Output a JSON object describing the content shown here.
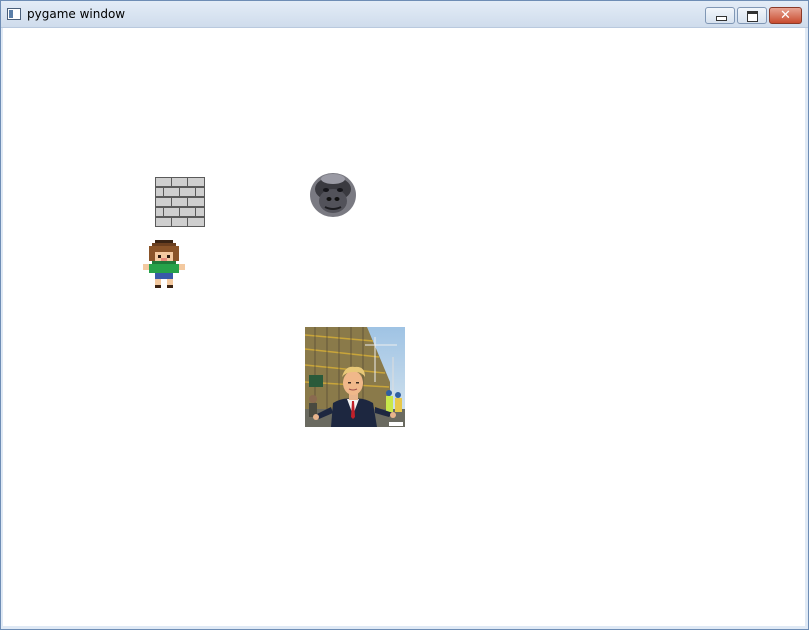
{
  "window": {
    "title": "pygame window",
    "icon": "pygame-app-icon",
    "controls": {
      "minimize": "minimize-icon",
      "maximize": "maximize-icon",
      "close": "close-icon"
    }
  },
  "canvas": {
    "background": "#ffffff",
    "sprites": [
      {
        "name": "brick-wall",
        "icon": "brick-wall-sprite"
      },
      {
        "name": "gorilla",
        "icon": "gorilla-face-sprite"
      },
      {
        "name": "girl",
        "icon": "pixel-girl-sprite"
      },
      {
        "name": "photo",
        "icon": "man-in-suit-photo-sprite"
      }
    ]
  },
  "colors": {
    "titlebar": "#dfe9f5",
    "close_button": "#c84b2f"
  }
}
